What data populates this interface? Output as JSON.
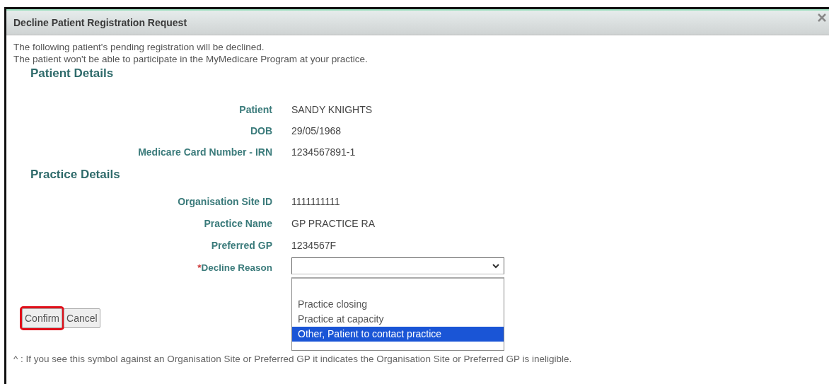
{
  "dialog": {
    "title": "Decline Patient Registration Request",
    "intro": [
      "The following patient's pending registration will be declined.",
      "The patient won't be able to participate in the MyMedicare Program at your practice."
    ],
    "sections": [
      {
        "heading": "Patient Details",
        "fields": [
          {
            "label": "Patient",
            "value": "SANDY KNIGHTS"
          },
          {
            "label": "DOB",
            "value": "29/05/1968"
          },
          {
            "label": "Medicare Card Number - IRN",
            "value": "1234567891-1"
          }
        ]
      },
      {
        "heading": "Practice Details",
        "fields": [
          {
            "label": "Organisation Site ID",
            "value": "1111111111"
          },
          {
            "label": "Practice Name",
            "value": "GP PRACTICE RA"
          },
          {
            "label": "Preferred GP",
            "value": "1234567F"
          }
        ]
      }
    ],
    "decline_reason": {
      "required_mark": "*",
      "label": "Decline Reason",
      "expanded": true,
      "options": [
        {
          "label": "Practice closing",
          "selected": false
        },
        {
          "label": "Practice at capacity",
          "selected": false
        },
        {
          "label": "Other, Patient to contact practice",
          "selected": true
        }
      ]
    },
    "buttons": [
      {
        "label": "Confirm",
        "highlighted": true
      },
      {
        "label": "Cancel",
        "highlighted": false
      }
    ],
    "footnote": "^ : If you see this symbol against an Organisation Site or Preferred GP it indicates the Organisation Site or Preferred GP is ineligible."
  }
}
